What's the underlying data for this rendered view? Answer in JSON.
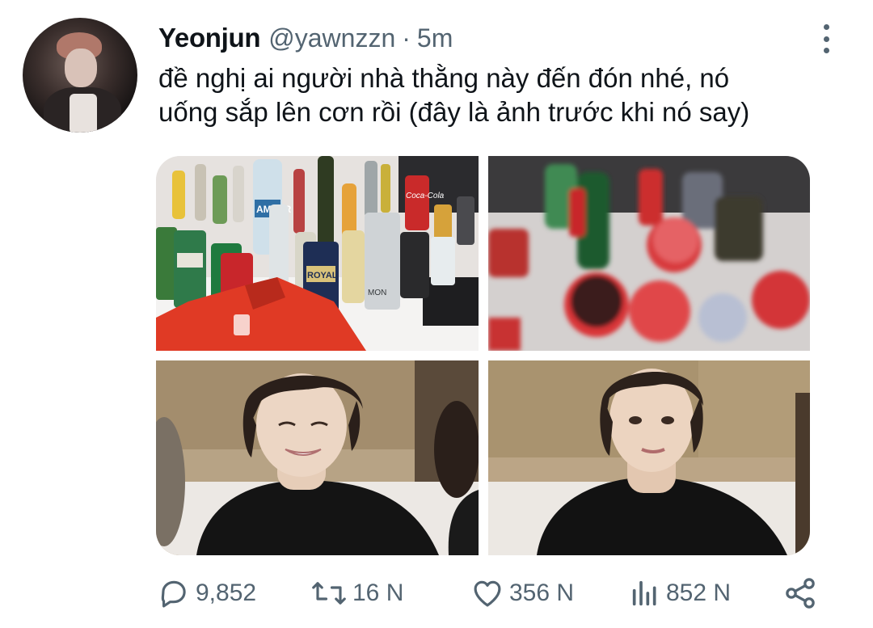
{
  "author": {
    "name": "Yeonjun",
    "handle": "@yawnzzn",
    "separator": "·",
    "time": "5m"
  },
  "tweet": {
    "lines": [
      "đề nghị ai người nhà thằng này đến đón nhé, nó",
      "uống sắp lên cơn rồi (đây là ảnh trước khi nó say)"
    ]
  },
  "media": {
    "photos": [
      {
        "label": "drinks-table-photo"
      },
      {
        "label": "blurry-cups-photo"
      },
      {
        "label": "smiling-man-photo"
      },
      {
        "label": "man-portrait-photo"
      }
    ],
    "can_text": [
      "AMPER",
      "Coca-Cola",
      "ROYAL",
      "MON"
    ]
  },
  "stats": {
    "replies": "9,852",
    "retweets": "16 N",
    "likes": "356 N",
    "views": "852 N"
  },
  "icons": {
    "reply": "comment-bubble-icon",
    "retweet": "retweet-icon",
    "like": "heart-icon",
    "views": "views-bar-chart-icon",
    "share": "share-icon",
    "more": "more-vertical-icon"
  },
  "colors": {
    "text_primary": "#0f1419",
    "text_secondary": "#536471"
  }
}
